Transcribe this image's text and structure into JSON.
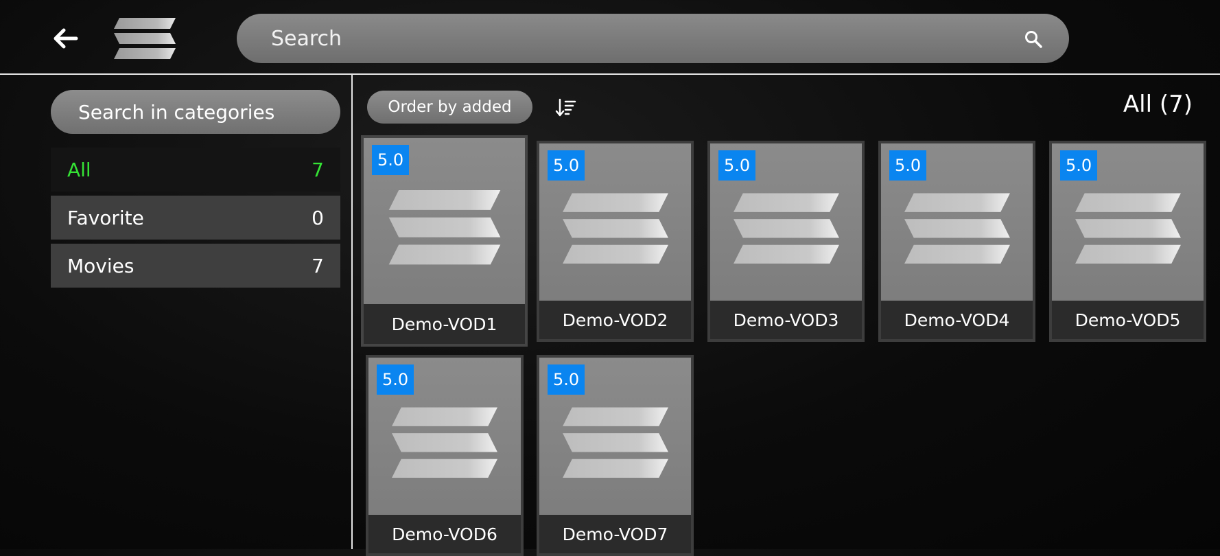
{
  "header": {
    "search_placeholder": "Search"
  },
  "sidebar": {
    "search_label": "Search in categories",
    "categories": [
      {
        "label": "All",
        "count": "7"
      },
      {
        "label": "Favorite",
        "count": "0"
      },
      {
        "label": "Movies",
        "count": "7"
      }
    ]
  },
  "toolbar": {
    "order_label": "Order by added",
    "count_title": "All (7)"
  },
  "items": [
    {
      "title": "Demo-VOD1",
      "rating": "5.0"
    },
    {
      "title": "Demo-VOD2",
      "rating": "5.0"
    },
    {
      "title": "Demo-VOD3",
      "rating": "5.0"
    },
    {
      "title": "Demo-VOD4",
      "rating": "5.0"
    },
    {
      "title": "Demo-VOD5",
      "rating": "5.0"
    },
    {
      "title": "Demo-VOD6",
      "rating": "5.0"
    },
    {
      "title": "Demo-VOD7",
      "rating": "5.0"
    }
  ],
  "colors": {
    "accent_green": "#35e335",
    "rating_badge": "#0a85f0"
  },
  "icons": {
    "back": "back-arrow-icon",
    "logo": "stripes-logo-icon",
    "search": "search-icon",
    "sort": "sort-icon",
    "placeholder": "stripes-placeholder-icon"
  }
}
